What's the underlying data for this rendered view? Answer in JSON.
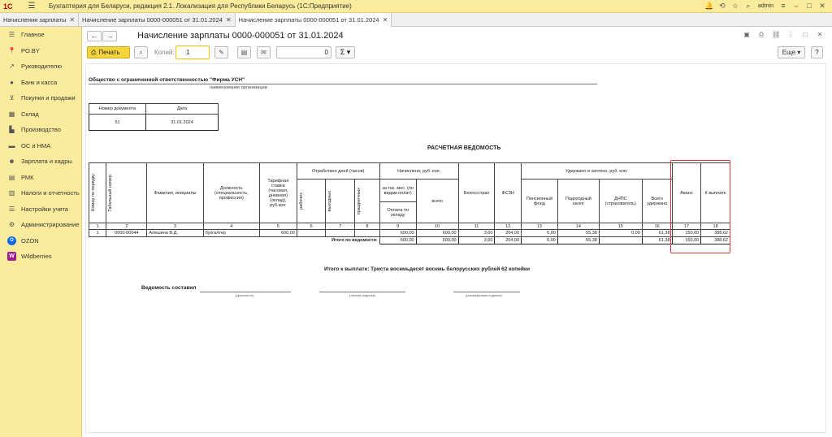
{
  "app": {
    "title": "Бухгалтерия для Беларуси, редакция 2.1. Локализация для Республики Беларусь  (1С:Предприятие)",
    "user": "admin"
  },
  "tabs": [
    {
      "label": "Начисления зарплаты"
    },
    {
      "label": "Начисление зарплаты 0000-000051 от 31.01.2024"
    },
    {
      "label": "Начисление зарплаты 0000-000051 от 31.01.2024"
    }
  ],
  "sidebar": {
    "items": [
      {
        "label": "Главное",
        "icon": "menu-icon"
      },
      {
        "label": "PO.BY",
        "icon": "pin-icon"
      },
      {
        "label": "Руководителю",
        "icon": "chart-icon"
      },
      {
        "label": "Банк и касса",
        "icon": "coin-icon"
      },
      {
        "label": "Покупки и продажи",
        "icon": "cart-icon"
      },
      {
        "label": "Склад",
        "icon": "warehouse-icon"
      },
      {
        "label": "Производство",
        "icon": "factory-icon"
      },
      {
        "label": "ОС и НМА",
        "icon": "car-icon"
      },
      {
        "label": "Зарплата и кадры",
        "icon": "people-icon"
      },
      {
        "label": "РМК",
        "icon": "register-icon"
      },
      {
        "label": "Налоги и отчетность",
        "icon": "report-icon"
      },
      {
        "label": "Настройки учета",
        "icon": "settings-icon"
      },
      {
        "label": "Администрирование",
        "icon": "gear-icon"
      },
      {
        "label": "OZON",
        "icon": "ozon-icon"
      },
      {
        "label": "Wildberries",
        "icon": "wb-icon"
      }
    ]
  },
  "document": {
    "title": "Начисление зарплаты 0000-000051 от 31.01.2024"
  },
  "toolbar": {
    "print_label": "Печать",
    "copies_label": "Копий:",
    "copies_value": "1",
    "sum_value": "0",
    "more_label": "Еще",
    "help_label": "?"
  },
  "report": {
    "org_name": "Общество с ограниченной ответственностью \"Фирма УСН\"",
    "org_caption": "наименование организации",
    "docnum_header": "Номер документа",
    "date_header": "Дата",
    "docnum": "51",
    "date": "31.01.2024",
    "title": "РАСЧЕТНАЯ ВЕДОМОСТЬ",
    "headers": {
      "n": "Номер по порядку",
      "tab": "Табельный номер",
      "fio": "Фамилия, инициалы",
      "pos": "Должность (специальность, профессия)",
      "rate": "Тарифная ставка (часовая, дневная) (оклад), руб.коп.",
      "worked": "Отработано дней (часов)",
      "work": "рабочих",
      "weekend": "выходных",
      "holiday": "праздничных",
      "accrued": "Начислено, руб. коп.",
      "accrued_type": "за тек. мес. (по видам оплат)",
      "salary": "Оплата по окладу",
      "total": "всего",
      "belgos": "Белгосстрах",
      "fszn": "ФСЗН",
      "withheld": "Удержано и зачтено, руб. коп.",
      "pension": "Пенсионный фонд",
      "income_tax": "Подоходный налог",
      "dnps": "ДНПС (страхователь)",
      "total_withheld": "Всего удержано",
      "advance": "Аванс",
      "payable": "К выплате"
    },
    "colnums": [
      "1",
      "2",
      "3",
      "4",
      "5",
      "6",
      "7",
      "8",
      "9",
      "10",
      "11",
      "12",
      "13",
      "14",
      "15",
      "16",
      "17",
      "18"
    ],
    "rows": [
      {
        "n": "1",
        "tab": "0000-00044",
        "fio": "Алешина В.Д.",
        "pos": "бухгалтер",
        "rate": "600,00",
        "work": "",
        "weekend": "",
        "holiday": "",
        "salary": "600,00",
        "total": "600,00",
        "belgos": "3,60",
        "fszn": "204,00",
        "pension": "6,00",
        "income_tax": "55,38",
        "dnps": "0,00",
        "total_withheld": "61,38",
        "advance": "150,00",
        "payable": "388,62"
      }
    ],
    "totals": {
      "label": "Итого по ведомости:",
      "salary": "600,00",
      "total": "600,00",
      "belgos": "3,60",
      "fszn": "204,00",
      "pension": "6,00",
      "income_tax": "55,38",
      "total_withheld": "61,38",
      "advance": "150,00",
      "payable": "388,62"
    },
    "total_payable_text": "Итого к выплате:  Триста восемьдесят восемь белорусских рублей 62 копейки",
    "compiled_label": "Ведомость составил",
    "sig_position": "(должность)",
    "sig_personal": "(личная подпись)",
    "sig_decode": "(расшифровка подписи)"
  }
}
